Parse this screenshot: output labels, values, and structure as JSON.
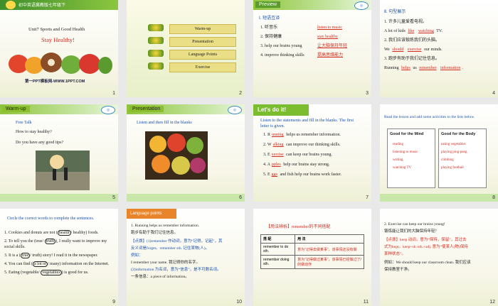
{
  "slides": [
    {
      "num": "1",
      "header": "初中英语冀教版七年级下",
      "unit": "Unit7  Sports and Good Health",
      "lesson": "Stay Healthy!",
      "footer": "第一PPT模板网-WWW.1PPT.COM"
    },
    {
      "num": "2",
      "menu": [
        "Warm-up",
        "Presentation",
        "Language Points",
        "Exercise"
      ]
    },
    {
      "num": "3",
      "tag": "Preview",
      "title": "Ⅰ. 短语互译",
      "items": [
        "1. 听音乐",
        "2. 保持健康",
        "3. help our brains young",
        "4. improve thinking  skills"
      ],
      "answers": [
        "listen to music",
        "stay healthy",
        "让大脑保持年轻",
        "提高思维能力"
      ]
    },
    {
      "num": "4",
      "title": "Ⅱ. 句型展示",
      "lines": [
        "1. 许多儿童爱看电视。",
        "A lot of kids ___ ___ TV.",
        "2. 我们应该锻炼我们的头脑。",
        "We ___ ___ our minds.",
        "3. 跑步有助于我们记住信息。",
        "Running ___ us ___ ___."
      ],
      "answers": [
        "like",
        "watching",
        "should",
        "exercise",
        "helps",
        "remember",
        "information"
      ]
    },
    {
      "num": "5",
      "tag": "Warm-up",
      "lines": [
        "Free Talk",
        "How to stay healthy?",
        "Do you have any good tips?"
      ]
    },
    {
      "num": "6",
      "tag": "Presentation",
      "text": "Listen and then fill in the blanks"
    },
    {
      "num": "7",
      "tag": "Let's do it!",
      "intro": [
        "Listen to the statements and fill in the blanks. The first",
        "letter is given."
      ],
      "items": [
        "1. R______ helps us remember  information.",
        "2. W______ can improve our thinking skills.",
        "3. E______ can keep our brains young.",
        "4. A______ help our brains stay strong.",
        "5. E_____ and fish help our brains work faster."
      ],
      "answers": [
        "unning",
        "alking",
        "xercise",
        "pples",
        "ggs"
      ]
    },
    {
      "num": "8",
      "title": "Read the lesson and add some activities to the lists below.",
      "mind_head": "Good for the Mind",
      "body_head": "Good for the Body",
      "mind": [
        "reading",
        "listening to music",
        "writing",
        "watching TV"
      ],
      "body": [
        "eating vegetables",
        "playing ping-pang",
        "climbing",
        "playing football"
      ]
    },
    {
      "num": "9",
      "intro": "Circle  the  correct  words  to complete  the  sentences.",
      "items": [
        "1.    Cookies and donuts are not (health/ healthy) foods.",
        "2.    To tell you the (true/ truth), I really want to improve my",
        "       social skills.",
        "3.    It is a (true/ truth) story! I read it in the newspaper.",
        "4.    You can find (a lot of/ many) information on the Internet.",
        "5.    Eating (vegetable/ vegetables) is good for us."
      ]
    },
    {
      "num": "10",
      "tag": "Language points",
      "lines": [
        "1. Running helps us remember information.",
        "跑步有助于我们记住信息。",
        "【点拨】(1)remember 作动词，意为“记得，记起”，其",
        "反义词是forget。remember sth. 记住某物(人)。",
        "例如：",
        "I remember your name. 我记得你的名字。",
        "(2)information 为名词，意为“信息”，是不可数名词。",
        "一条信息：a piece of information。"
      ]
    },
    {
      "num": "11",
      "title": "【用法辨析】remember的不同搭配",
      "headers": [
        "搭  配",
        "用  法"
      ],
      "rows": [
        [
          "remember to do sth.",
          "意为“记得去做某事”，该事情还没有做"
        ],
        [
          "remember doing sth.",
          "意为“记得做过某事”，该事情已经做过了/的做动作"
        ]
      ]
    },
    {
      "num": "12",
      "lines": [
        "2. Exercise can keep our brains young!",
        "锻炼能让我们的大脑保持年轻！",
        "【点拨】keep 动词，意为“保持，保留”，其过去",
        "式为kept。keep+sb./sth.+adj. 意为“使某人(物)保持",
        "某种状态”。",
        "例如：We should keep our classroom clean. 我们应该",
        "保持教室干净。"
      ]
    }
  ]
}
